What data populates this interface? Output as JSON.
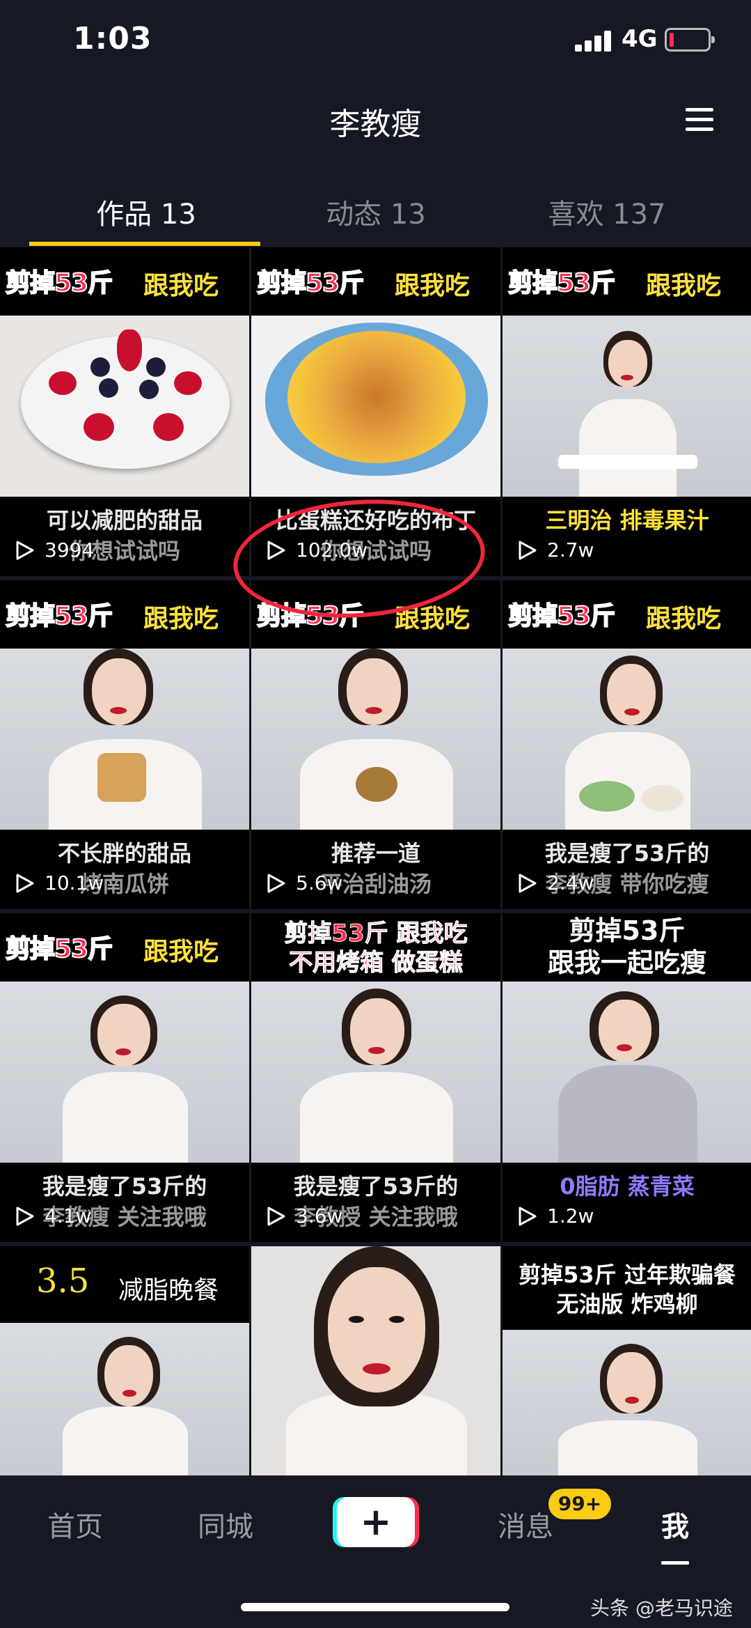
{
  "status": {
    "time": "1:03",
    "network": "4G"
  },
  "header": {
    "title": "李教瘦"
  },
  "tabs": [
    {
      "label": "作品 13"
    },
    {
      "label": "动态 13"
    },
    {
      "label": "喜欢 137"
    }
  ],
  "videos": [
    {
      "header_red": "剪掉53斤",
      "header_yellow": "跟我吃",
      "caption1": "可以减肥的甜品",
      "caption2": "你想试试吗",
      "views": "3994"
    },
    {
      "header_red": "剪掉53斤",
      "header_yellow": "跟我吃",
      "caption1": "比蛋糕还好吃的布丁",
      "caption2": "你想试试吗",
      "views": "102.0w"
    },
    {
      "header_red": "剪掉53斤",
      "header_yellow": "跟我吃",
      "caption1": "三明治  排毒果汁",
      "caption2": "",
      "views": "2.7w"
    },
    {
      "header_red": "剪掉53斤",
      "header_yellow": "跟我吃",
      "caption1": "不长胖的甜品",
      "caption2": "烤南瓜饼",
      "views": "10.1w"
    },
    {
      "header_red": "剪掉53斤",
      "header_yellow": "跟我吃",
      "caption1": "推荐一道",
      "caption2": "平治刮油汤",
      "views": "5.6w"
    },
    {
      "header_red": "剪掉53斤",
      "header_yellow": "跟我吃",
      "caption1": "我是瘦了53斤的",
      "caption2": "李教瘦  带你吃瘦",
      "views": "2.4w"
    },
    {
      "header_red": "剪掉53斤",
      "header_yellow": "跟我吃",
      "caption1": "我是瘦了53斤的",
      "caption2": "李教瘦 关注我哦",
      "views": "4.1w"
    },
    {
      "header_line1": "剪掉53斤 跟我吃",
      "header_line2": "不用烤箱 做蛋糕",
      "caption1": "我是瘦了53斤的",
      "caption2": "李教授 关注我哦",
      "views": "3.6w"
    },
    {
      "header_line1": "剪掉53斤",
      "header_line2": "跟我一起吃瘦",
      "caption1": "0脂肪 蒸青菜",
      "caption2": "",
      "views": "1.2w"
    },
    {
      "header_num": "3.5",
      "header_text": "减脂晚餐"
    },
    {},
    {
      "header_line1": "剪掉53斤  过年欺骗餐",
      "header_line2": "无油版  炸鸡柳"
    }
  ],
  "nav": {
    "home": "首页",
    "local": "同城",
    "create": "+",
    "messages": "消息",
    "messages_badge": "99+",
    "me": "我"
  },
  "watermark": "头条 @老马识途"
}
